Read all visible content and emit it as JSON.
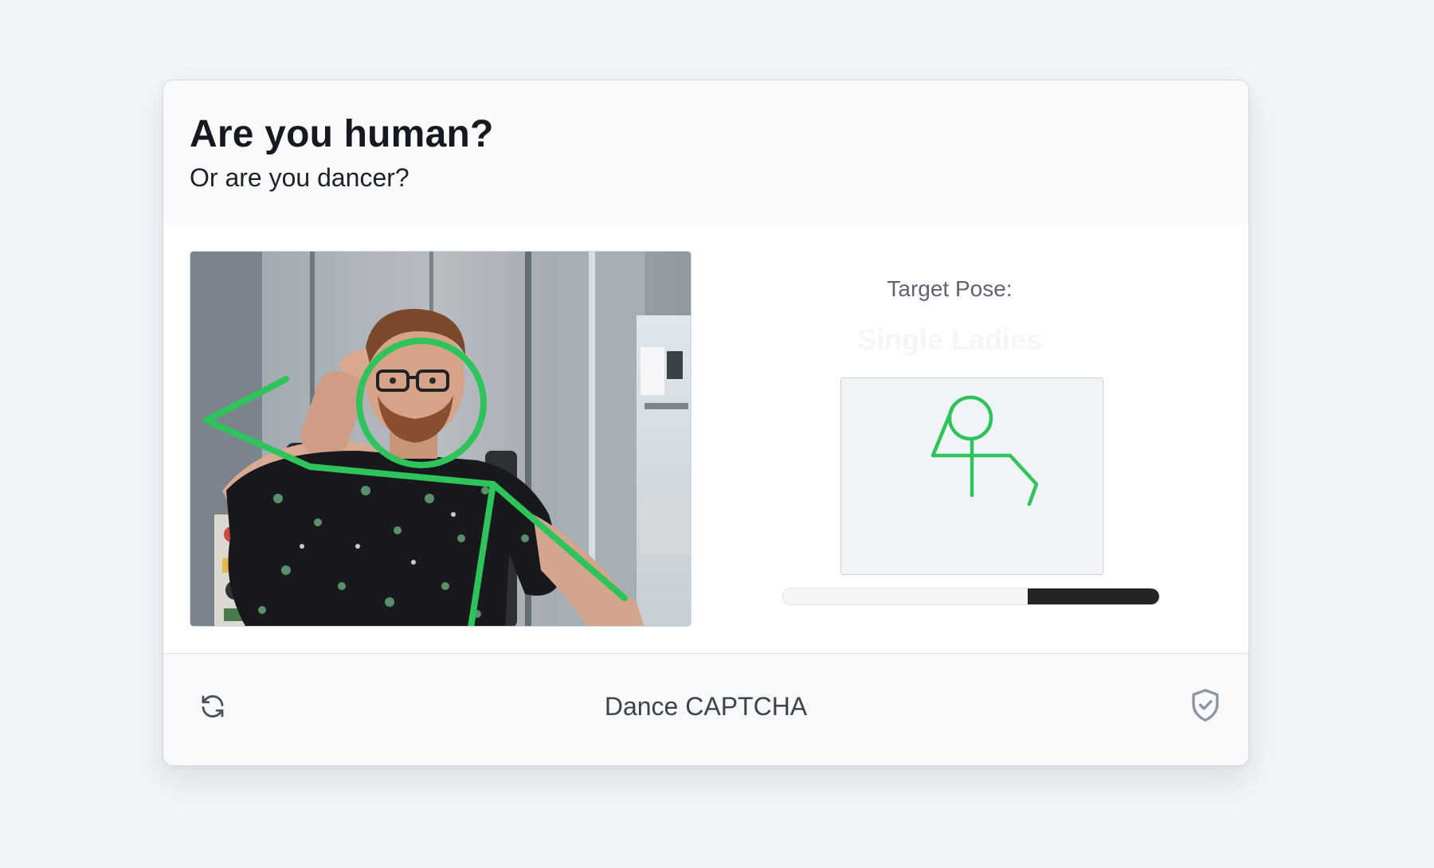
{
  "header": {
    "title": "Are you human?",
    "subtitle": "Or are you dancer?"
  },
  "camera": {
    "skeleton_color": "#2fc45b"
  },
  "target": {
    "label": "Target Pose:",
    "pose_name": "Single Ladies",
    "figure_color": "#2fc45b"
  },
  "progress": {
    "fraction": 0.35,
    "fill_color": "#222426"
  },
  "footer": {
    "title": "Dance CAPTCHA",
    "refresh_icon": "refresh-icon",
    "shield_icon": "shield-check-icon"
  }
}
